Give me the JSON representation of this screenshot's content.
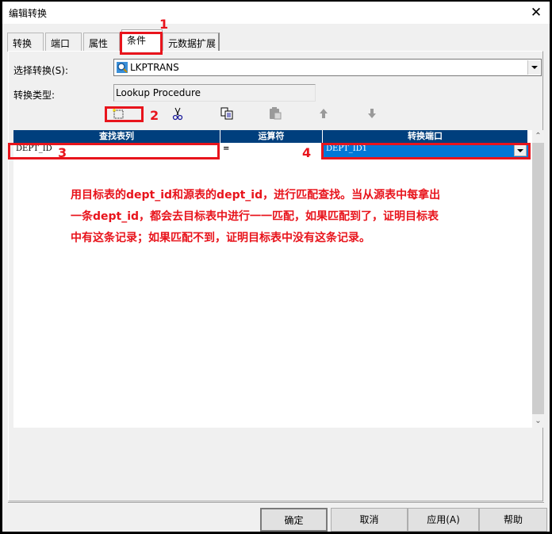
{
  "window": {
    "title": "编辑转换",
    "close_icon": "close-icon"
  },
  "tabs": [
    {
      "label": "转换",
      "active": false
    },
    {
      "label": "端口",
      "active": false
    },
    {
      "label": "属性",
      "active": false
    },
    {
      "label": "条件",
      "active": true
    },
    {
      "label": "元数据扩展",
      "active": false
    }
  ],
  "form": {
    "select_transform_label": "选择转换(S):",
    "select_transform_value": "LKPTRANS",
    "transform_type_label": "转换类型:",
    "transform_type_value": "Lookup Procedure"
  },
  "toolbar": {
    "items": [
      {
        "name": "new-condition",
        "icon": "new-icon",
        "enabled": true
      },
      {
        "name": "cut",
        "icon": "scissors-icon",
        "enabled": true
      },
      {
        "name": "copy",
        "icon": "copy-icon",
        "enabled": true
      },
      {
        "name": "paste",
        "icon": "paste-icon",
        "enabled": false
      },
      {
        "name": "move-up",
        "icon": "arrow-up-icon",
        "enabled": false
      },
      {
        "name": "move-down",
        "icon": "arrow-down-icon",
        "enabled": false
      }
    ]
  },
  "grid": {
    "columns": [
      "查找表列",
      "运算符",
      "转换端口"
    ],
    "rows": [
      {
        "lookup_column": "DEPT_ID",
        "operator": "=",
        "port": "DEPT_ID1"
      }
    ]
  },
  "annotations": {
    "markers": [
      "1",
      "2",
      "3",
      "4"
    ],
    "note": "用目标表的dept_id和源表的dept_id，进行匹配查找。当从源表中每拿出一条dept_id，都会去目标表中进行一一匹配，如果匹配到了，证明目标表中有这条记录；如果匹配不到，证明目标表中没有这条记录。",
    "color": "#e8141c"
  },
  "buttons": {
    "ok": "确定",
    "cancel": "取消",
    "apply": "应用(A)",
    "help": "帮助"
  },
  "colors": {
    "grid_header": "#003f7d",
    "selection": "#0078d7"
  }
}
